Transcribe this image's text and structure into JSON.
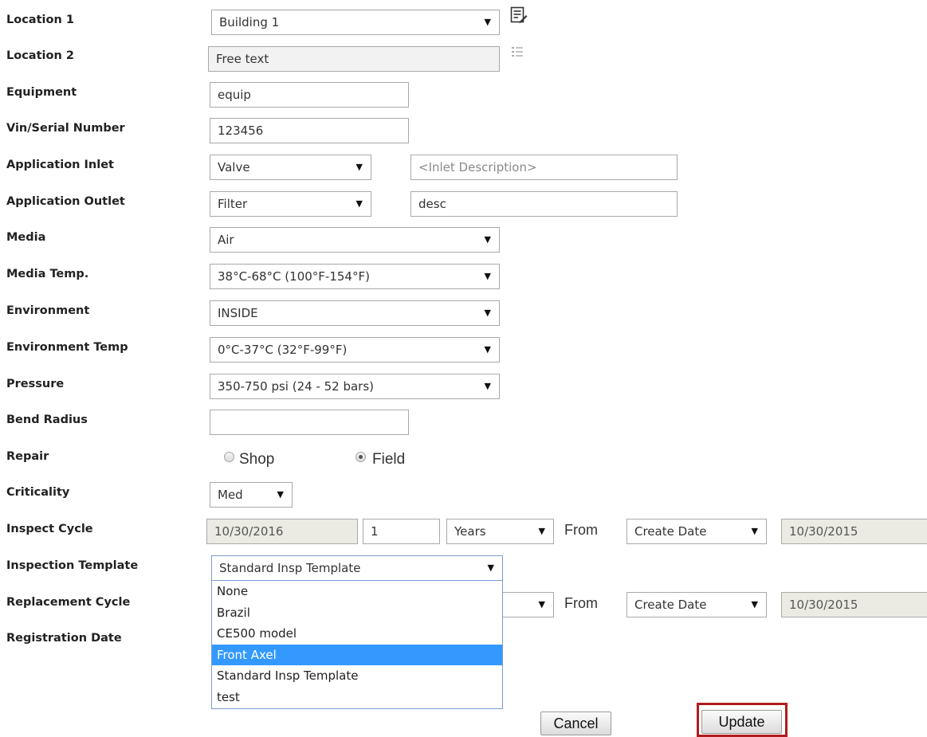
{
  "labels": {
    "location1": "Location 1",
    "location2": "Location 2",
    "equipment": "Equipment",
    "vin": "Vin/Serial Number",
    "inlet": "Application Inlet",
    "outlet": "Application Outlet",
    "media": "Media",
    "media_temp": "Media Temp.",
    "environment": "Environment",
    "env_temp": "Environment Temp",
    "pressure": "Pressure",
    "bend_radius": "Bend Radius",
    "repair": "Repair",
    "criticality": "Criticality",
    "inspect_cycle": "Inspect Cycle",
    "inspection_template": "Inspection Template",
    "replacement_cycle": "Replacement Cycle",
    "registration_date": "Registration Date"
  },
  "fields": {
    "location1": "Building 1",
    "location2": "Free text",
    "equipment": "equip",
    "vin": "123456",
    "inlet_select": "Valve",
    "inlet_desc_placeholder": "<Inlet Description>",
    "outlet_select": "Filter",
    "outlet_desc": "desc",
    "media": "Air",
    "media_temp": "38°C-68°C (100°F-154°F)",
    "environment": "INSIDE",
    "env_temp": "0°C-37°C (32°F-99°F)",
    "pressure": "350-750 psi (24 - 52 bars)",
    "bend_radius": "",
    "criticality": "Med",
    "inspection_template": "Standard Insp Template"
  },
  "repair": {
    "options": [
      "Shop",
      "Field"
    ],
    "selected": "Field"
  },
  "inspect_cycle": {
    "date": "10/30/2016",
    "interval": "1",
    "unit": "Years",
    "from_label": "From",
    "from_select": "Create Date",
    "from_date": "10/30/2015"
  },
  "replacement_cycle": {
    "from_label": "From",
    "from_select": "Create Date",
    "from_date": "10/30/2015"
  },
  "template_dropdown": {
    "options": [
      "None",
      "Brazil",
      "CE500 model",
      "Front Axel",
      "Standard Insp Template",
      "test"
    ],
    "highlighted": "Front Axel"
  },
  "buttons": {
    "cancel": "Cancel",
    "update": "Update"
  },
  "icons": {
    "location1_icon": "edit-list-icon",
    "location2_icon": "list-icon"
  },
  "colors": {
    "highlight": "#3399ff",
    "update_border": "#b01c1c"
  }
}
